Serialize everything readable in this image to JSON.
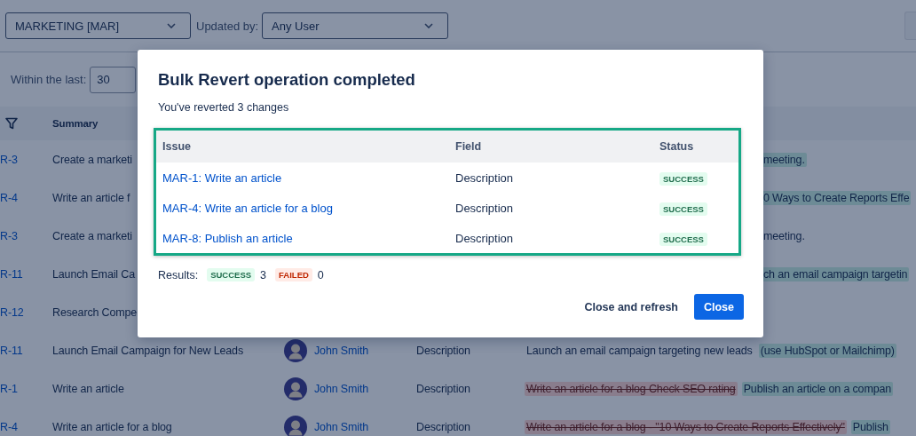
{
  "toolbar": {
    "project_select": "MARKETING [MAR]",
    "updated_by_label": "Updated by:",
    "updated_by_select": "Any User"
  },
  "filter": {
    "label": "Within the last:",
    "value": "30"
  },
  "table": {
    "columns": [
      "Summary"
    ],
    "rows": [
      {
        "key": "R-3",
        "summary": "Create a marketi",
        "change": [
          {
            "text": "meeting.",
            "kind": "added"
          }
        ]
      },
      {
        "key": "R-4",
        "summary": "Write an article f",
        "change": [
          {
            "text": "0 Ways to Create Reports Effe",
            "kind": "added"
          }
        ]
      },
      {
        "key": "R-3",
        "summary": "Create a marketi",
        "change": [
          {
            "text": "meeting.",
            "kind": "plain"
          }
        ]
      },
      {
        "key": "R-11",
        "summary": "Launch Email Ca",
        "change": [
          {
            "text": "ch an email campaign targetin",
            "kind": "added"
          }
        ]
      },
      {
        "key": "R-12",
        "summary": "Research Compe",
        "change": []
      },
      {
        "key": "R-11",
        "summary": "Launch Email Campaign for New Leads",
        "author": "John Smith",
        "field": "Description",
        "change": [
          {
            "text": "Launch an email campaign targeting new leads",
            "kind": "plain"
          },
          {
            "text": "(use HubSpot or Mailchimp)",
            "kind": "added"
          }
        ]
      },
      {
        "key": "R-1",
        "summary": "Write an article",
        "author": "John Smith",
        "field": "Description",
        "change": [
          {
            "text": "Write an article for a blog Check SEO rating",
            "kind": "removed"
          },
          {
            "text": "Publish an article on a compan",
            "kind": "added"
          }
        ]
      },
      {
        "key": "R-4",
        "summary": "Write an article for a blog",
        "author": "John Smith",
        "field": "Description",
        "change": [
          {
            "text": "Write an article for a blog - \"10 Ways to Create Reports Effectively\"",
            "kind": "removed"
          },
          {
            "text": "Publish",
            "kind": "added"
          }
        ]
      }
    ]
  },
  "dialog": {
    "title": "Bulk Revert operation completed",
    "subtitle": "You've reverted 3 changes",
    "columns": [
      "Issue",
      "Field",
      "Status"
    ],
    "rows": [
      {
        "issue": "MAR-1: Write an article",
        "field": "Description",
        "status": "SUCCESS",
        "kind": "success"
      },
      {
        "issue": "MAR-4: Write an article for a blog",
        "field": "Description",
        "status": "SUCCESS",
        "kind": "success"
      },
      {
        "issue": "MAR-8: Publish an article",
        "field": "Description",
        "status": "SUCCESS",
        "kind": "success"
      }
    ],
    "results": {
      "label": "Results:",
      "items": [
        {
          "badge": "SUCCESS",
          "kind": "success",
          "count": "3"
        },
        {
          "badge": "FAILED",
          "kind": "failed",
          "count": "0"
        }
      ]
    },
    "buttons": [
      {
        "label": "Close and refresh",
        "kind": "subtle"
      },
      {
        "label": "Close",
        "kind": "primary"
      }
    ]
  }
}
